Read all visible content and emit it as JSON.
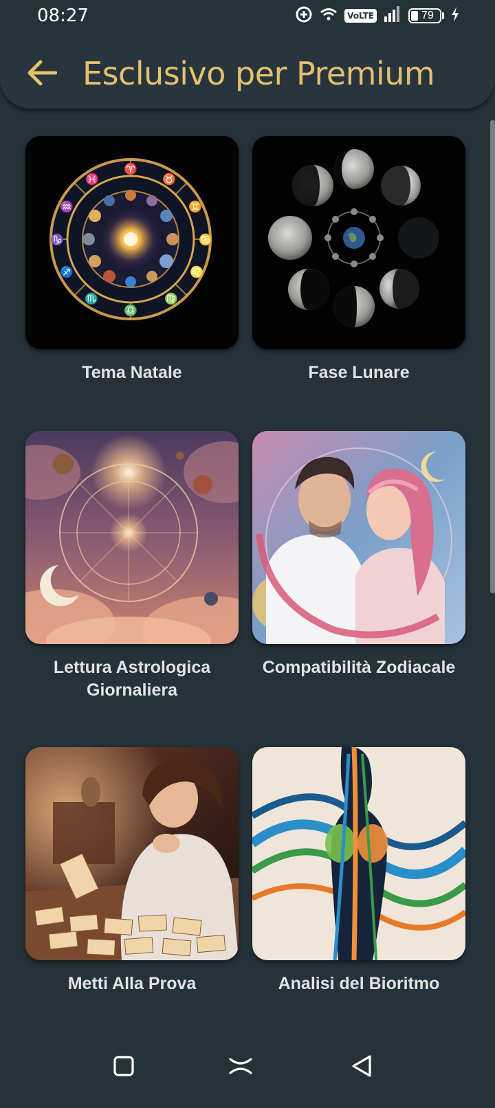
{
  "status_bar": {
    "time": "08:27",
    "network_badge": "VoLTE",
    "battery": "79"
  },
  "header": {
    "title": "Esclusivo per Premium"
  },
  "cards": [
    {
      "label": "Tema Natale",
      "image": "zodiac-wheel-image"
    },
    {
      "label": "Fase Lunare",
      "image": "moon-phases-image"
    },
    {
      "label": "Lettura Astrologica Giornaliera",
      "image": "cosmic-zodiac-clouds-image"
    },
    {
      "label": "Compatibilità Zodiacale",
      "image": "couple-romance-image"
    },
    {
      "label": "Metti Alla Prova",
      "image": "tarot-reader-image"
    },
    {
      "label": "Analisi del Bioritmo",
      "image": "biorhythm-figure-image"
    }
  ],
  "colors": {
    "background": "#26323a",
    "accent": "#e4c06f",
    "label": "#e0e3e5"
  },
  "icons": {
    "back": "arrow-left-icon",
    "nav_home": "square-icon",
    "nav_recents": "double-chevron-icon",
    "nav_back": "triangle-back-icon"
  }
}
